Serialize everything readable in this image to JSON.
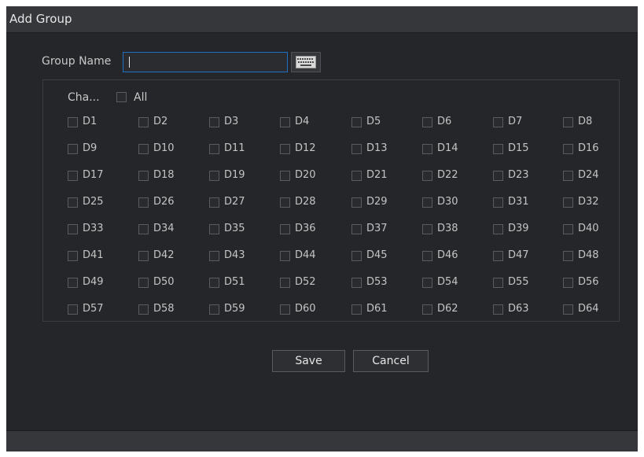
{
  "dialog": {
    "title": "Add Group"
  },
  "group_name": {
    "label": "Group Name",
    "value": ""
  },
  "channels": {
    "header_label": "Cha...",
    "all_label": "All",
    "items": [
      "D1",
      "D2",
      "D3",
      "D4",
      "D5",
      "D6",
      "D7",
      "D8",
      "D9",
      "D10",
      "D11",
      "D12",
      "D13",
      "D14",
      "D15",
      "D16",
      "D17",
      "D18",
      "D19",
      "D20",
      "D21",
      "D22",
      "D23",
      "D24",
      "D25",
      "D26",
      "D27",
      "D28",
      "D29",
      "D30",
      "D31",
      "D32",
      "D33",
      "D34",
      "D35",
      "D36",
      "D37",
      "D38",
      "D39",
      "D40",
      "D41",
      "D42",
      "D43",
      "D44",
      "D45",
      "D46",
      "D47",
      "D48",
      "D49",
      "D50",
      "D51",
      "D52",
      "D53",
      "D54",
      "D55",
      "D56",
      "D57",
      "D58",
      "D59",
      "D60",
      "D61",
      "D62",
      "D63",
      "D64"
    ]
  },
  "buttons": {
    "save": "Save",
    "cancel": "Cancel"
  },
  "icons": {
    "keyboard": "keyboard-icon"
  },
  "colors": {
    "background": "#252629",
    "titlebar": "#36373b",
    "input_focus_border": "#1f6fc2",
    "text": "#c4c4c4"
  }
}
